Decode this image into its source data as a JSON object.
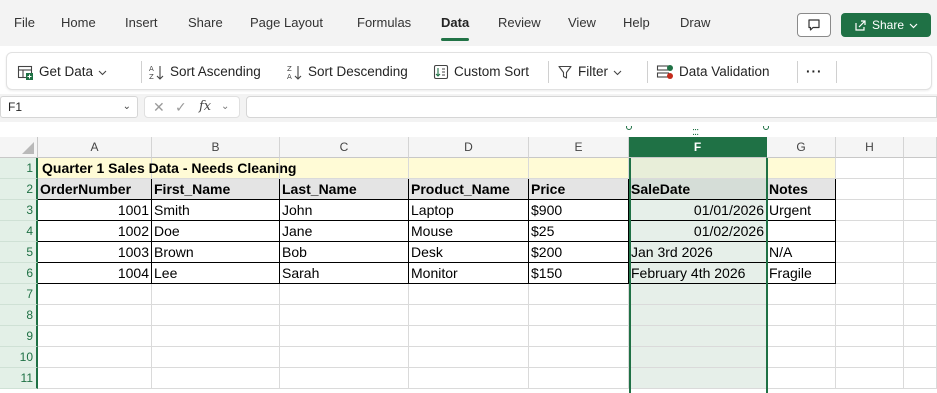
{
  "menu": {
    "tabs": [
      "File",
      "Home",
      "Insert",
      "Share",
      "Page Layout",
      "Formulas",
      "Data",
      "Review",
      "View",
      "Help",
      "Draw"
    ],
    "active": "Data",
    "share_label": "Share"
  },
  "ribbon": {
    "get_data": "Get Data",
    "sort_asc": "Sort Ascending",
    "sort_desc": "Sort Descending",
    "custom_sort": "Custom Sort",
    "filter": "Filter",
    "data_validation": "Data Validation",
    "more": "···"
  },
  "formula_bar": {
    "name_box": "F1",
    "fx_label": "fx",
    "formula": ""
  },
  "sheet": {
    "columns": [
      "A",
      "B",
      "C",
      "D",
      "E",
      "F",
      "G",
      "H"
    ],
    "selected_column": "F",
    "row_numbers": [
      "1",
      "2",
      "3",
      "4",
      "5",
      "6",
      "7",
      "8",
      "9",
      "10",
      "11"
    ],
    "title": "Quarter 1 Sales Data - Needs Cleaning",
    "headers": [
      "OrderNumber",
      "First_Name",
      "Last_Name",
      "Product_Name",
      "Price",
      "SaleDate",
      "Notes"
    ],
    "rows": [
      [
        "1001",
        "Smith",
        "John",
        "Laptop",
        "$900",
        "01/01/2026",
        "Urgent"
      ],
      [
        "1002",
        "Doe",
        "Jane",
        "Mouse",
        "$25",
        "01/02/2026",
        ""
      ],
      [
        "1003",
        "Brown",
        "Bob",
        "Desk",
        "$200",
        "Jan 3rd 2026",
        "N/A"
      ],
      [
        "1004",
        "Lee",
        "Sarah",
        "Monitor",
        "$150",
        "February 4th 2026",
        "Fragile"
      ]
    ]
  },
  "colors": {
    "accent": "#1f7145",
    "title_fill": "#fffbd6",
    "header_fill": "#e4e4e4"
  }
}
